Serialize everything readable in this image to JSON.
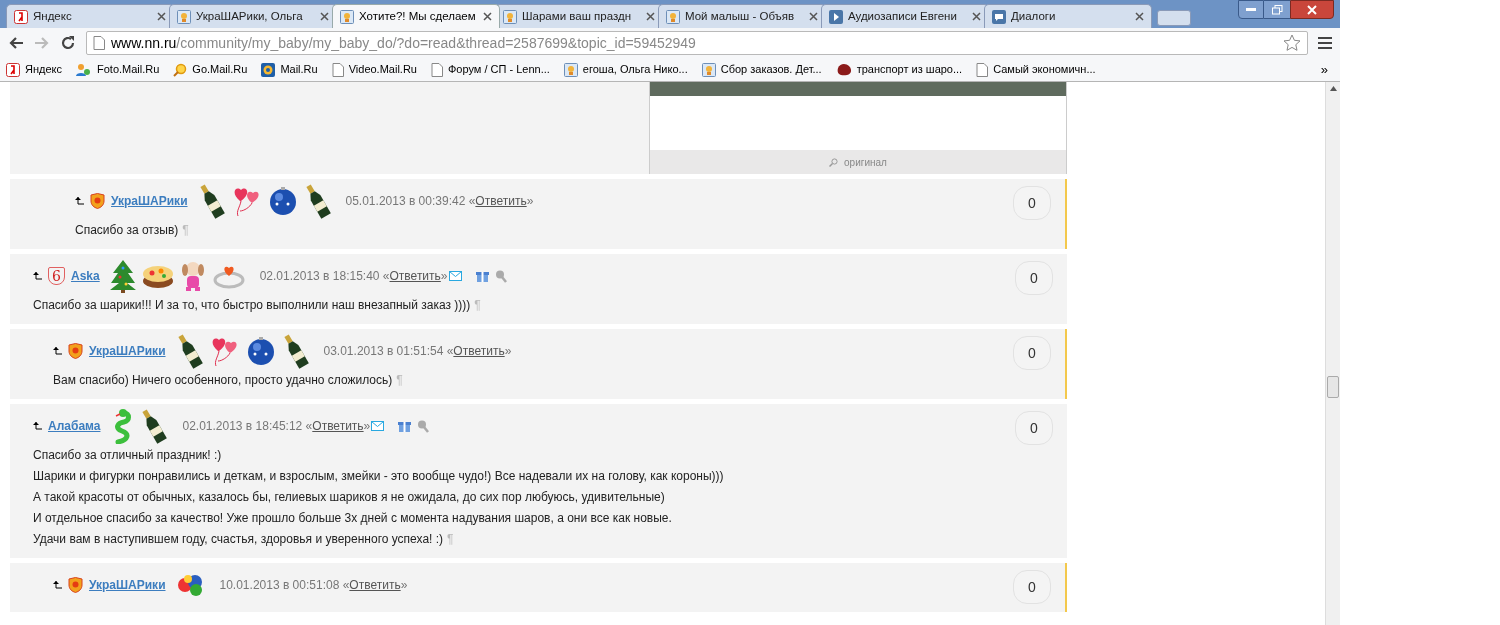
{
  "tabs": [
    {
      "title": "Яндекс",
      "kind": "yandex",
      "selected": false
    },
    {
      "title": "УкраШАРики, Ольга",
      "kind": "page",
      "selected": false
    },
    {
      "title": "Хотите?! Мы сделаем",
      "kind": "page",
      "selected": true
    },
    {
      "title": "Шарами ваш праздн",
      "kind": "page",
      "selected": false
    },
    {
      "title": "Мой малыш - Объяв",
      "kind": "page",
      "selected": false
    },
    {
      "title": "Аудиозаписи Евгени",
      "kind": "play",
      "selected": false
    },
    {
      "title": "Диалоги",
      "kind": "chat",
      "selected": false
    }
  ],
  "address": {
    "host": "www.nn.ru",
    "path": "/community/my_baby/my_baby_do/?do=read&thread=2587699&topic_id=59452949"
  },
  "bookmarks": [
    {
      "label": "Яндекс",
      "kind": "yandex"
    },
    {
      "label": "Foto.Mail.Ru",
      "kind": "people"
    },
    {
      "label": "Go.Mail.Ru",
      "kind": "search"
    },
    {
      "label": "Mail.Ru",
      "kind": "at"
    },
    {
      "label": "Video.Mail.Ru",
      "kind": "doc"
    },
    {
      "label": "Форум / СП - Lenn...",
      "kind": "doc"
    },
    {
      "label": "егоша, Ольга Нико...",
      "kind": "page"
    },
    {
      "label": "Сбор заказов. Дет...",
      "kind": "page"
    },
    {
      "label": "транспорт из шаро...",
      "kind": "blot"
    },
    {
      "label": "Самый экономичн...",
      "kind": "doc"
    }
  ],
  "bookmarks_more": "»",
  "previous_comment": {
    "image_link": "оригинал",
    "replies": [
      {
        "author": "УкраШАРики",
        "badge": {
          "kind": "shield"
        },
        "gifts": [
          {
            "kind": "champagne"
          },
          {
            "kind": "hearts"
          },
          {
            "kind": "ornament"
          },
          {
            "kind": "champagne"
          }
        ],
        "date": "05.01.2013 в 00:39:42",
        "quote_open": "«",
        "reply": "Ответить",
        "quote_close": "»",
        "lines": [
          "Спасибо за отзыв)"
        ],
        "pilcrow": "¶",
        "votes": "0"
      }
    ]
  },
  "comments": [
    {
      "author": "Aska",
      "badge": {
        "kind": "outline",
        "text": "6"
      },
      "gifts": [
        {
          "kind": "tree"
        },
        {
          "kind": "cake"
        },
        {
          "kind": "dog"
        },
        {
          "kind": "ring"
        }
      ],
      "date": "02.01.2013 в 18:15:40",
      "quote_open": "«",
      "reply": "Ответить",
      "quote_close": "»",
      "actions": true,
      "lines": [
        "Спасибо за шарики!!! И за то, что быстро выполнили наш внезапный заказ ))))"
      ],
      "pilcrow": "¶",
      "votes": "0",
      "replies": [
        {
          "author": "УкраШАРики",
          "badge": {
            "kind": "shield"
          },
          "gifts": [
            {
              "kind": "champagne"
            },
            {
              "kind": "hearts"
            },
            {
              "kind": "ornament"
            },
            {
              "kind": "champagne"
            }
          ],
          "date": "03.01.2013 в 01:51:54",
          "quote_open": "«",
          "reply": "Ответить",
          "quote_close": "»",
          "lines": [
            "Вам спасибо) Ничего особенного, просто удачно сложилось)"
          ],
          "pilcrow": "¶",
          "votes": "0"
        }
      ]
    },
    {
      "author": "Алабама",
      "gifts": [
        {
          "kind": "snake"
        },
        {
          "kind": "champagne"
        }
      ],
      "date": "02.01.2013 в 18:45:12",
      "quote_open": "«",
      "reply": "Ответить",
      "quote_close": "»",
      "actions": true,
      "lines": [
        "Спасибо за отличный праздник! :)",
        "Шарики и фигурки понравились и деткам, и взрослым, змейки - это вообще чудо!) Все надевали их на голову, как короны)))",
        "А такой красоты от обычных, казалось бы, гелиевых шариков я не ожидала, до сих пор любуюсь, удивительные)",
        "И отдельное спасибо за качество! Уже прошло больше 3х дней с момента надувания шаров, а они все как новые.",
        "Удачи вам в наступившем году, счастья, здоровья и уверенного успеха! :)"
      ],
      "pilcrow": "¶",
      "votes": "0",
      "replies": [
        {
          "author": "УкраШАРики",
          "badge": {
            "kind": "shield"
          },
          "gifts": [
            {
              "kind": "balls"
            }
          ],
          "date": "10.01.2013 в 00:51:08",
          "quote_open": "«",
          "reply": "Ответить",
          "quote_close": "»",
          "votes": "0"
        }
      ]
    }
  ]
}
